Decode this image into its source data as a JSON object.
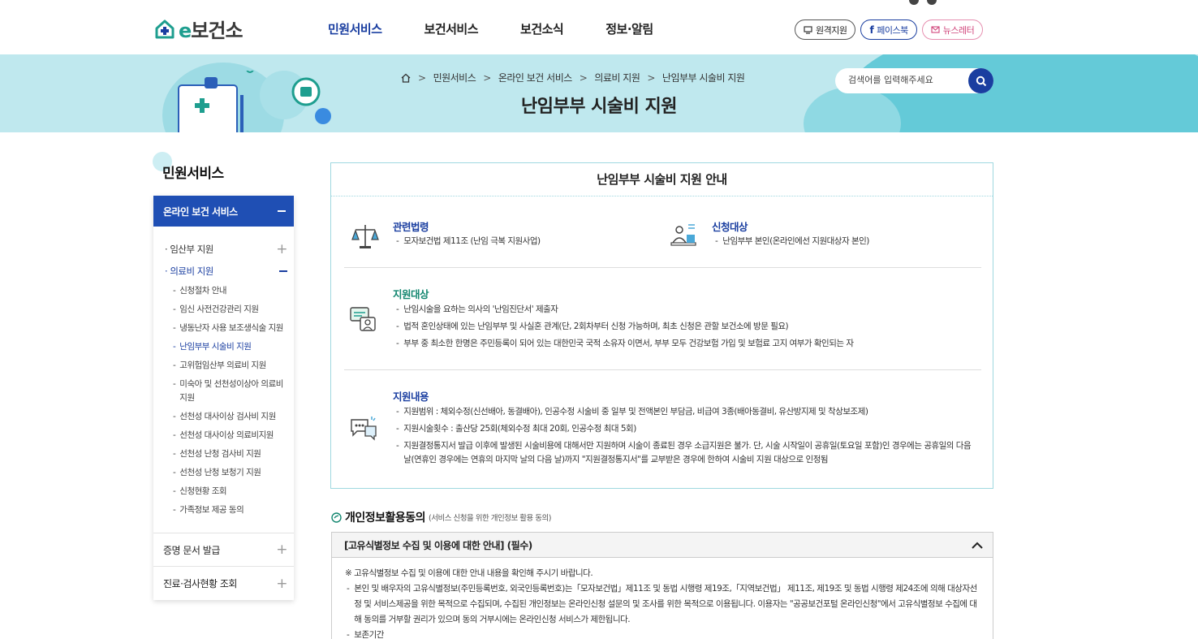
{
  "logo": {
    "e": "e",
    "text": "보건소"
  },
  "gnb": [
    "민원서비스",
    "보건서비스",
    "보건소식",
    "정보·알림"
  ],
  "util": {
    "remote": "원격지원",
    "facebook": "페이스북",
    "newsletter": "뉴스레터"
  },
  "breadcrumb": [
    "민원서비스",
    "온라인 보건 서비스",
    "의료비 지원",
    "난임부부 시술비 지원"
  ],
  "page_title": "난임부부 시술비 지원",
  "search": {
    "placeholder": "검색어를 입력해주세요"
  },
  "sidebar": {
    "title": "민원서비스",
    "active_group": "온라인 보건 서비스",
    "items": [
      {
        "label": "임산부 지원",
        "state": "plus"
      },
      {
        "label": "의료비 지원",
        "state": "minus"
      }
    ],
    "sub_items": [
      "신청절차 안내",
      "임신 사전건강관리 지원",
      "냉동난자 사용 보조생식술 지원",
      "난임부부 시술비 지원",
      "고위험임산부 의료비 지원",
      "미숙아 및 선천성이상아 의료비 지원",
      "선천성 대사이상 검사비 지원",
      "선천성 대사이상 의료비지원",
      "선천성 난청 검사비 지원",
      "선천성 난청 보청기 지원",
      "신청현황 조회",
      "가족정보 제공 동의"
    ],
    "others": [
      "증명 문서 발급",
      "진료·검사현황 조회"
    ]
  },
  "box": {
    "title": "난임부부 시술비 지원 안내",
    "law": {
      "heading": "관련법령",
      "items": [
        "모자보건법 제11조 (난임 극복 지원사업)"
      ]
    },
    "applicant": {
      "heading": "신청대상",
      "items": [
        "난임부부 본인(온라인에선 지원대상자 본인)"
      ]
    },
    "target": {
      "heading": "지원대상",
      "items": [
        "난임시술을 요하는 의사의 '난임진단서' 제출자",
        "법적 혼인상태에 있는 난임부부 및 사실혼 관계(단, 2회차부터 신청 가능하며, 최초 신청은 관할 보건소에 방문 필요)",
        "부부 중 최소한 한명은 주민등록이 되어 있는 대한민국 국적 소유자 이면서, 부부 모두 건강보험 가입 및 보험료 고지 여부가 확인되는 자"
      ]
    },
    "content": {
      "heading": "지원내용",
      "items": [
        "지원범위 : 체외수정(신선배아, 동결배아), 인공수정 시술비 중 일부 및 전액본인 부담금, 비급여 3종(배아동결비, 유산방지제 및 착상보조제)",
        "지원시술횟수 : 출산당 25회(체외수정 최대 20회, 인공수정 최대 5회)",
        "지원결정통지서 발급 이후에 발생된 시술비용에 대해서만 지원하며 시술이 종료된 경우 소급지원은 불가. 단, 시술 시작일이 공휴일(토요일 포함)인 경우에는 공휴일의 다음 날(연휴인 경우에는 연휴의 마지막 날의 다음 날)까지 \"지원결정통지서\"를 교부받은 경우에 한하여 시술비 지원 대상으로 인정됨"
      ]
    }
  },
  "privacy": {
    "title": "개인정보활용동의",
    "subtitle": "(서비스 신청을 위한 개인정보 활용 동의)",
    "accordion_title": "[고유식별정보 수집 및 이용에 대한 안내] (필수)",
    "note": "※ 고유식별정보 수집 및 이용에 대한 안내 내용을 확인해 주시기 바랍니다.",
    "items": [
      "본인 및 배우자의 고유식별정보(주민등록번호, 외국인등록번호)는「모자보건법」제11조 및 동법 시행령 제19조,「지역보건법」 제11조, 제19조 및 동법 시행령 제24조에 의해 대상자선정 및 서비스제공을 위한 목적으로 수집되며, 수집된 개인정보는 온라인신청 설문의 및 조사를 위한 목적으로 이용됩니다. 이용자는 \"공공보건포털 온라인신청\"에서 고유식별정보 수집에 대해 동의를 거부할 권리가 있으며 동의 거부시에는 온라인신청 서비스가 제한됩니다.",
      "보존기간"
    ]
  },
  "colors": {
    "primary": "#1a3ea0",
    "sidebar_head": "#1f4fb4",
    "banner": "#bfe8ee",
    "teal": "#12866f"
  }
}
